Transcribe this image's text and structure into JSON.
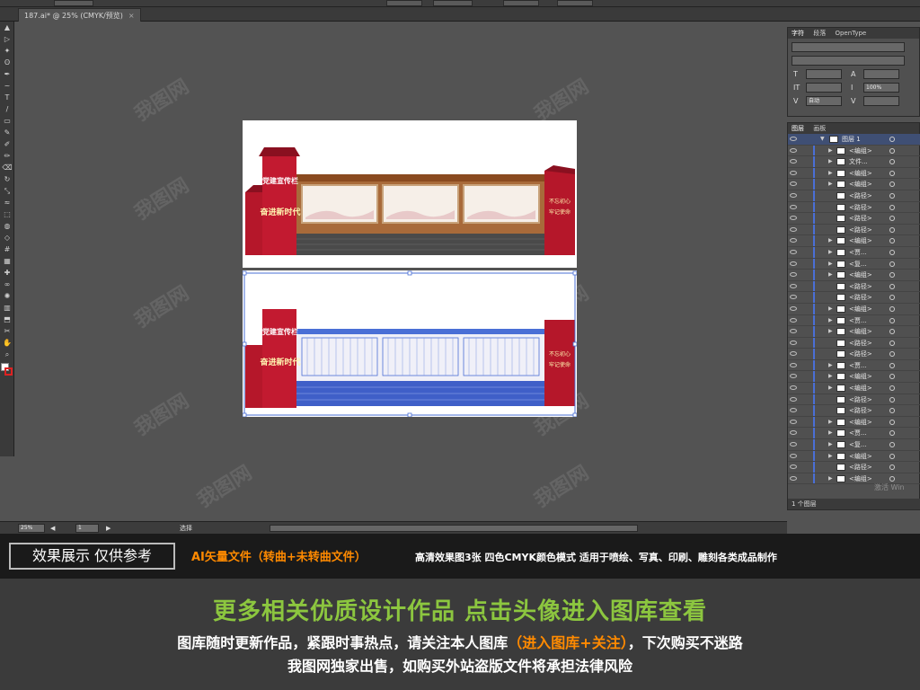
{
  "document": {
    "tab_title": "187.ai* @ 25% (CMYK/预览)",
    "tab_close": "×"
  },
  "toolbar": {
    "icons": [
      "selection-icon",
      "direct-selection-icon",
      "magic-wand-icon",
      "lasso-icon",
      "pen-icon",
      "curvature-icon",
      "type-icon",
      "line-icon",
      "rectangle-icon",
      "paintbrush-icon",
      "shaper-icon",
      "pencil-icon",
      "eraser-icon",
      "rotate-icon",
      "scale-icon",
      "width-icon",
      "free-transform-icon",
      "shape-builder-icon",
      "perspective-grid-icon",
      "mesh-icon",
      "gradient-icon",
      "eyedropper-icon",
      "blend-icon",
      "symbol-sprayer-icon",
      "column-graph-icon",
      "artboard-icon",
      "slice-icon",
      "hand-icon",
      "zoom-icon"
    ],
    "glyphs": [
      "▲",
      "▷",
      "✦",
      "ʘ",
      "✒",
      "~",
      "T",
      "/",
      "▭",
      "✎",
      "✐",
      "✏",
      "⌫",
      "↻",
      "⤡",
      "≈",
      "⬚",
      "◍",
      "◇",
      "#",
      "▦",
      "✚",
      "∞",
      "✺",
      "▥",
      "⬒",
      "✂",
      "✋",
      "⌕"
    ]
  },
  "character_panel": {
    "tabs": [
      "字符",
      "段落",
      "OpenType"
    ],
    "font_size": "",
    "leading": "",
    "scale_v": "",
    "scale_h": "100%",
    "kerning": "自动",
    "tracking": ""
  },
  "layers_panel": {
    "tabs": [
      "图层",
      "画板"
    ],
    "top_layer": "图层 1",
    "rows": [
      "<编组>",
      "文件...",
      "<编组>",
      "<编组>",
      "<路径>",
      "<路径>",
      "<路径>",
      "<路径>",
      "<编组>",
      "<贾...",
      "<复...",
      "<编组>",
      "<路径>",
      "<路径>",
      "<编组>",
      "<贾...",
      "<编组>",
      "<路径>",
      "<路径>",
      "<贾...",
      "<编组>",
      "<编组>",
      "<路径>",
      "<路径>",
      "<编组>",
      "<贾...",
      "<复...",
      "<编组>",
      "<路径>",
      "<编组>"
    ],
    "footer": "1 个图层",
    "activation_watermark": "激活 Win"
  },
  "statusbar": {
    "zoom": "25%",
    "artboard_num": "1",
    "tool_name": "选择"
  },
  "artwork": {
    "panel_top_labels": [
      "党建宣传栏",
      "奋进新时代"
    ],
    "panel_right_labels": [
      "不忘初心",
      "牢记使命"
    ]
  },
  "watermark_text": "我图网",
  "banner": {
    "promo_button": "效果展示 仅供参考",
    "orange_text": "AI矢量文件（转曲+未转曲文件）",
    "white_text": "高清效果图3张 四色CMYK颜色模式 适用于喷绘、写真、印刷、雕刻各类成品制作",
    "headline": "更多相关优质设计作品 点击头像进入图库查看",
    "line2_pre": "图库随时更新作品，紧跟时事热点，请关注本人图库",
    "line2_highlight": "（进入图库+关注）",
    "line2_post": "，下次购买不迷路",
    "line3": "我图网独家出售，如购买外站盗版文件将承担法律风险"
  },
  "colors": {
    "brand_red": "#b5172a",
    "brick": "#4a4a4a",
    "select_blue": "#4a6fd6",
    "promo_orange": "#ff8a00",
    "headline_green": "#8cc63f"
  }
}
